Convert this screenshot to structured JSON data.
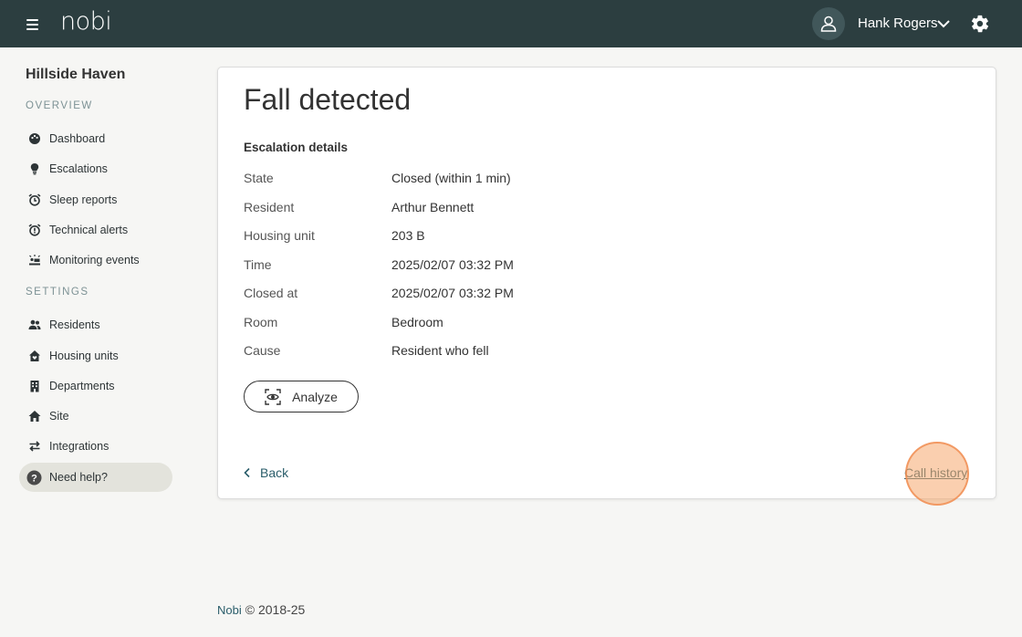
{
  "header": {
    "logo": "nobi",
    "user_name": "Hank Rogers",
    "icons": [
      "hamburger-icon",
      "user-icon",
      "chevron-down-icon",
      "gear-icon"
    ]
  },
  "sidebar": {
    "site_name": "Hillside Haven",
    "overview_title": "OVERVIEW",
    "settings_title": "SETTINGS",
    "overview_items": [
      {
        "label": "Dashboard",
        "icon": "palette-icon"
      },
      {
        "label": "Escalations",
        "icon": "lightbulb-icon"
      },
      {
        "label": "Sleep reports",
        "icon": "alarm-clock-icon"
      },
      {
        "label": "Technical alerts",
        "icon": "alarm-alert-icon"
      },
      {
        "label": "Monitoring events",
        "icon": "monitoring-icon"
      }
    ],
    "settings_items": [
      {
        "label": "Residents",
        "icon": "people-icon"
      },
      {
        "label": "Housing units",
        "icon": "house-heart-icon"
      },
      {
        "label": "Departments",
        "icon": "building-icon"
      },
      {
        "label": "Site",
        "icon": "home-icon"
      },
      {
        "label": "Integrations",
        "icon": "swap-arrows-icon"
      }
    ],
    "help_label": "Need help?"
  },
  "card": {
    "title": "Fall detected",
    "subtitle": "Escalation details",
    "rows": [
      {
        "label": "State",
        "value": "Closed (within 1 min)"
      },
      {
        "label": "Resident",
        "value": "Arthur Bennett"
      },
      {
        "label": "Housing unit",
        "value": "203 B"
      },
      {
        "label": "Time",
        "value": "2025/02/07 03:32 PM"
      },
      {
        "label": "Closed at",
        "value": "2025/02/07 03:32 PM"
      },
      {
        "label": "Room",
        "value": "Bedroom"
      },
      {
        "label": "Cause",
        "value": "Resident who fell"
      }
    ],
    "analyze_label": "Analyze",
    "back_label": "Back",
    "call_history_label": "Call history"
  },
  "footer": {
    "brand": "Nobi",
    "copyright": "© 2018-25"
  },
  "colors": {
    "topbar": "#2c3e40",
    "background": "#f6f6f4",
    "link": "#2a5d6a",
    "highlight": "#f6a86e"
  }
}
